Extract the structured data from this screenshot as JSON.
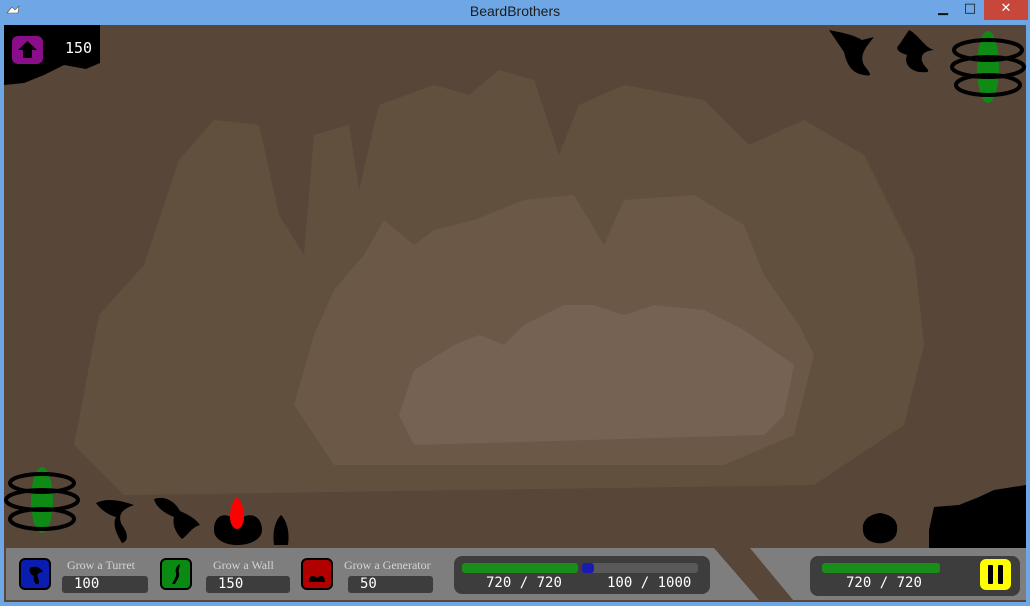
{
  "window": {
    "title": "BeardBrothers"
  },
  "resources": {
    "value": "150"
  },
  "build_menu": [
    {
      "label": "Grow a Turret",
      "cost": "100",
      "color": "#0b1cb0"
    },
    {
      "label": "Grow a Wall",
      "cost": "150",
      "color": "#0a8a13"
    },
    {
      "label": "Grow a Generator",
      "cost": "50",
      "color": "#b10000"
    }
  ],
  "player_stats": {
    "health": {
      "current": "720",
      "max": "720",
      "fraction": 1.0
    },
    "energy": {
      "current": "100",
      "max": "1000",
      "fraction": 0.1
    },
    "separator": "/"
  },
  "enemy_stats": {
    "health": {
      "current": "720",
      "max": "720",
      "fraction": 1.0
    },
    "separator": "/"
  },
  "colors": {
    "health": "#1a8c1a",
    "energy": "#1a1ab0",
    "pause": "#ffff00",
    "resource_icon": "#8a0d8a"
  },
  "icons": [
    "home-icon",
    "turret-icon",
    "wall-icon",
    "generator-icon",
    "pause-icon"
  ]
}
